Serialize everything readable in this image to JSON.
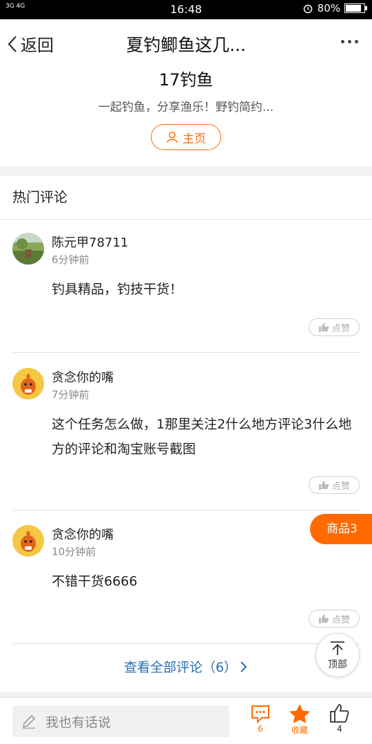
{
  "status_bar": {
    "network": "3G 4G",
    "time": "16:48",
    "battery": "80%",
    "battery_level": 0.8
  },
  "nav": {
    "back_label": "返回",
    "title": "夏钓鲫鱼这几..."
  },
  "author": {
    "name": "17钓鱼",
    "description": "一起钓鱼，分享渔乐！野钓简约...",
    "home_button": "主页"
  },
  "hot_comments_title": "热门评论",
  "comments": [
    {
      "user": "陈元甲78711",
      "time": "6分钟前",
      "text": "钓具精品，钓技干货！",
      "like_label": "点赞"
    },
    {
      "user": "贪念你的嘴",
      "time": "7分钟前",
      "text": "这个任务怎么做，1那里关注2什么地方评论3什么地方的评论和淘宝账号截图",
      "like_label": "点赞"
    },
    {
      "user": "贪念你的嘴",
      "time": "10分钟前",
      "text": "不错干货6666",
      "like_label": "点赞"
    }
  ],
  "goods_tab": "商品3",
  "view_all": "查看全部评论（6）",
  "to_top_label": "顶部",
  "bottom_bar": {
    "input_placeholder": "我也有话说",
    "comment_count": "6",
    "favorite_label": "收藏",
    "like_count": "4"
  },
  "colors": {
    "accent": "#ff6a00",
    "link": "#2a6db3"
  }
}
